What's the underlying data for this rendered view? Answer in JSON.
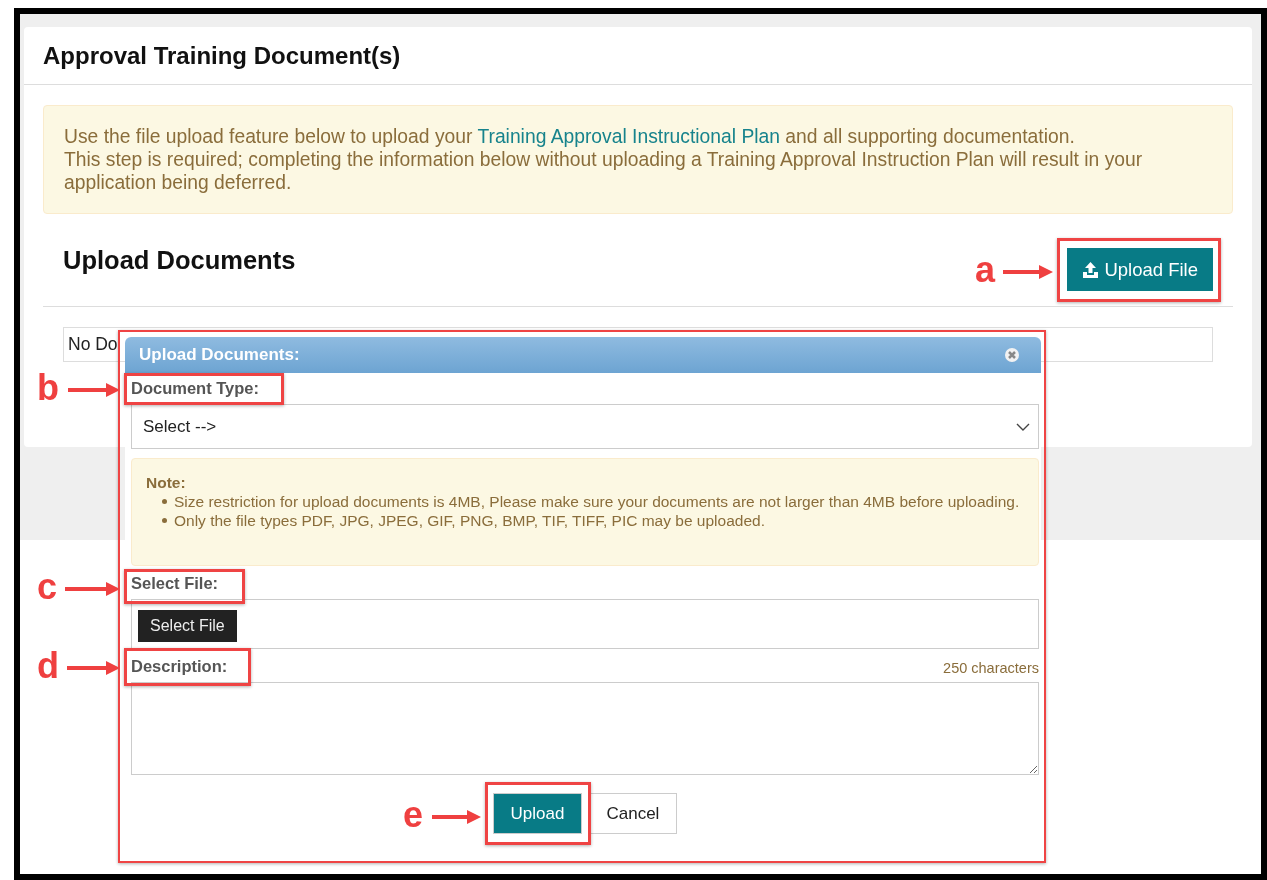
{
  "panel": {
    "title": "Approval Training Document(s)",
    "alert": {
      "text_before": "Use the file upload feature below to upload your ",
      "link": "Training Approval Instructional Plan",
      "text_after": " and all supporting documentation.",
      "requirement": "This step is required; completing the information below without uploading a Training Approval Instruction Plan will result in your application being deferred."
    },
    "section_title": "Upload Documents",
    "upload_button": "Upload File",
    "documents_list": "No Do"
  },
  "dialog": {
    "title": "Upload Documents:",
    "document_type": {
      "label": "Document Type:",
      "value": "Select -->"
    },
    "note": {
      "title": "Note:",
      "items": [
        "Size restriction for upload documents is 4MB, Please make sure your documents are not larger than 4MB before uploading.",
        "Only the file types PDF, JPG, JPEG, GIF, PNG, BMP, TIF, TIFF, PIC may be uploaded."
      ]
    },
    "select_file": {
      "label": "Select File:",
      "button": "Select File"
    },
    "description": {
      "label": "Description:",
      "limit": "250 characters"
    },
    "buttons": [
      {
        "label": "Upload",
        "kind": "primary"
      },
      {
        "label": "Cancel",
        "kind": "secondary"
      }
    ]
  },
  "annotations": [
    {
      "label": "a"
    },
    {
      "label": "b"
    },
    {
      "label": "c"
    },
    {
      "label": "d"
    },
    {
      "label": "e"
    }
  ]
}
